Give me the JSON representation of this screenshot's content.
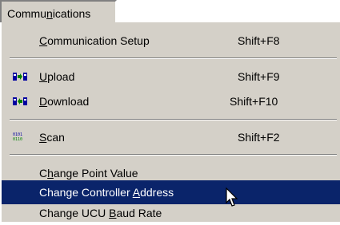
{
  "menubar": {
    "title_pre": "Commu",
    "title_key": "n",
    "title_post": "ications"
  },
  "menu": {
    "setup": {
      "pre": "",
      "key": "C",
      "post": "ommunication Setup",
      "shortcut": "Shift+F8"
    },
    "upload": {
      "pre": "",
      "key": "U",
      "post": "pload",
      "shortcut": "Shift+F9",
      "icon": "upload-icon"
    },
    "download": {
      "pre": "",
      "key": "D",
      "post": "ownload",
      "shortcut": "Shift+F10",
      "icon": "download-icon"
    },
    "scan": {
      "pre": "",
      "key": "S",
      "post": "can",
      "shortcut": "Shift+F2",
      "icon": "scan-icon"
    },
    "point_value": {
      "pre": "C",
      "key": "h",
      "post": "ange Point Value"
    },
    "controller_address": {
      "pre": "Change Controller ",
      "key": "A",
      "post": "ddress"
    },
    "baud_rate": {
      "pre": "Change UCU ",
      "key": "B",
      "post": "aud Rate"
    }
  },
  "colors": {
    "menu_bg": "#d4d0c8",
    "highlight": "#0a246a",
    "icon_blue": "#0000a0",
    "icon_green": "#008000"
  }
}
